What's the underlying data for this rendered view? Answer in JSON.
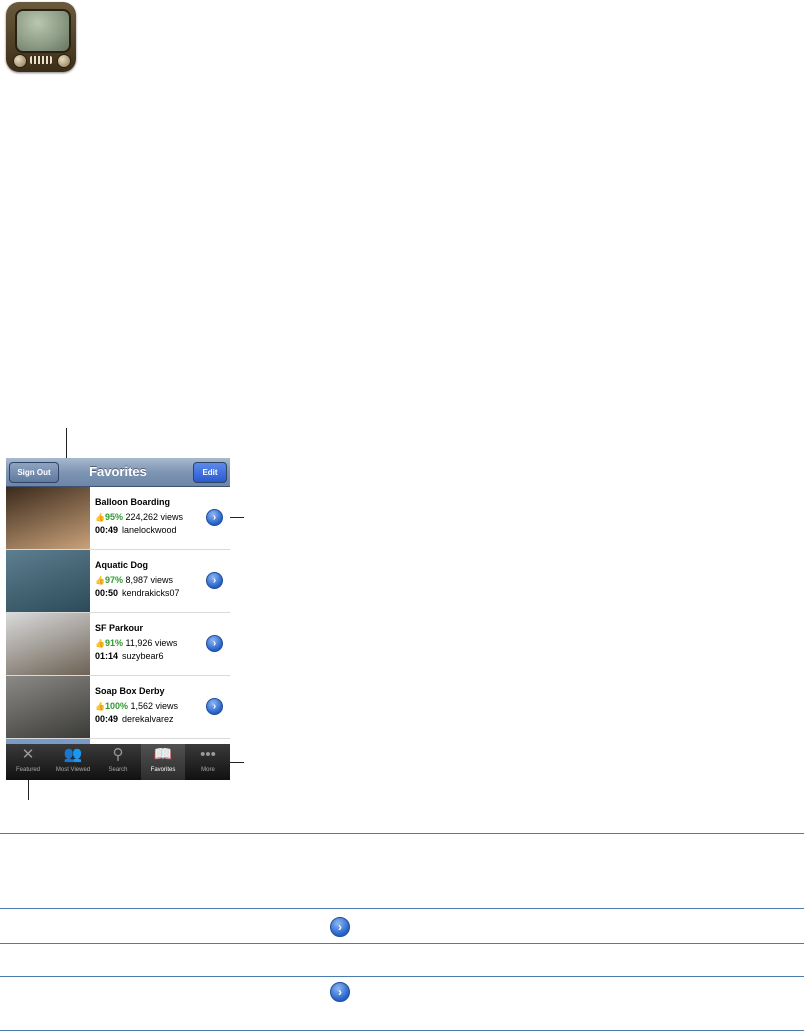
{
  "app_icon": {
    "name": "youtube-tv-icon"
  },
  "phone": {
    "navbar": {
      "title": "Favorites",
      "left_button": "Sign Out",
      "right_button": "Edit"
    },
    "videos": [
      {
        "title": "Balloon Boarding",
        "rating": "95%",
        "views": "224,262 views",
        "duration": "00:49",
        "user": "lanelockwood",
        "thumb_colors": [
          "#3b2a1c",
          "#c9a27a"
        ]
      },
      {
        "title": "Aquatic Dog",
        "rating": "97%",
        "views": "8,987 views",
        "duration": "00:50",
        "user": "kendrakicks07",
        "thumb_colors": [
          "#5d7f8f",
          "#2c4a5a"
        ]
      },
      {
        "title": "SF Parkour",
        "rating": "91%",
        "views": "11,926 views",
        "duration": "01:14",
        "user": "suzybear6",
        "thumb_colors": [
          "#d9dadb",
          "#6d6254"
        ]
      },
      {
        "title": "Soap Box Derby",
        "rating": "100%",
        "views": "1,562 views",
        "duration": "00:49",
        "user": "derekalvarez",
        "thumb_colors": [
          "#8c8a86",
          "#3a3a38"
        ]
      }
    ],
    "tabs": [
      {
        "label": "Featured",
        "icon": "featured-icon",
        "glyph": "✕"
      },
      {
        "label": "Most Viewed",
        "icon": "most-viewed-icon",
        "glyph": "👥"
      },
      {
        "label": "Search",
        "icon": "search-icon",
        "glyph": "⚲"
      },
      {
        "label": "Favorites",
        "icon": "favorites-icon",
        "glyph": "📖"
      },
      {
        "label": "More",
        "icon": "more-icon",
        "glyph": "•••"
      }
    ],
    "active_tab": "Favorites"
  },
  "table": {
    "rows": [
      {
        "disclosure": false
      },
      {
        "disclosure": true
      },
      {
        "disclosure": false
      },
      {
        "disclosure": true
      }
    ]
  },
  "colors": {
    "rule": "#4a7cb0",
    "navbar": "#7e95b4",
    "disclosure": "#2460c8",
    "rating_green": "#2e9a2e"
  }
}
